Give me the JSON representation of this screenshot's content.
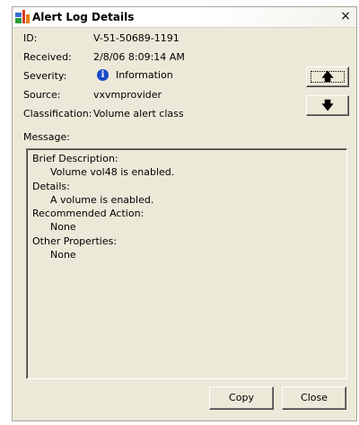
{
  "window": {
    "title": "Alert Log Details",
    "close_glyph": "×"
  },
  "fields": {
    "id_label": "ID:",
    "id_value": "V-51-50689-1191",
    "received_label": "Received:",
    "received_value": "2/8/06 8:09:14 AM",
    "severity_label": "Severity:",
    "severity_value": "Information",
    "severity_icon": "info-icon",
    "source_label": "Source:",
    "source_value": "vxvmprovider",
    "classification_label": "Classification:",
    "classification_value": "Volume alert class"
  },
  "message": {
    "label": "Message:",
    "lines": [
      {
        "type": "heading",
        "text": "Brief Description:"
      },
      {
        "type": "body",
        "text": "Volume vol48 is enabled."
      },
      {
        "type": "heading",
        "text": "Details:"
      },
      {
        "type": "body",
        "text": "A volume is enabled."
      },
      {
        "type": "heading",
        "text": "Recommended Action:"
      },
      {
        "type": "body",
        "text": "None"
      },
      {
        "type": "heading",
        "text": "Other Properties:"
      },
      {
        "type": "body",
        "text": "None"
      }
    ]
  },
  "buttons": {
    "up_glyph": "🡅",
    "down_glyph": "🡇",
    "copy": "Copy",
    "close": "Close"
  },
  "colors": {
    "dialog_bg": "#ece9d8",
    "info_icon": "#1b49c8"
  }
}
